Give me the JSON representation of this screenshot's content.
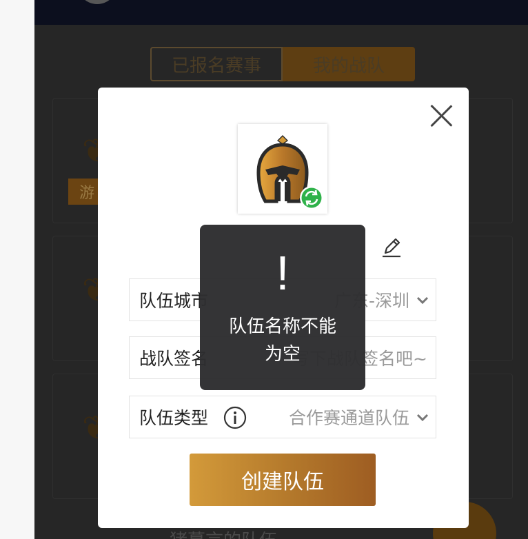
{
  "tabs": [
    "已报名赛事",
    "我的战队"
  ],
  "background_cards": [
    {
      "tag": "游"
    },
    {
      "tag": ""
    },
    {
      "tag": ""
    }
  ],
  "background_bottom_title": "猪蔓言的队伍",
  "modal": {
    "fields": [
      {
        "label": "队伍城市",
        "value": "广东-深圳",
        "icon": "chevron-down-icon"
      },
      {
        "label": "战队签名",
        "placeholder": "写下战队签名吧~"
      },
      {
        "label": "队伍类型",
        "value": "合作赛通道队伍",
        "icon": "chevron-down-icon",
        "info_icon": "info-icon"
      }
    ],
    "create_button": "创建队伍"
  },
  "toast": {
    "icon": "!",
    "message_line1": "队伍名称不能",
    "message_line2": "为空"
  },
  "colors": {
    "gold_start": "#d39a3a",
    "gold_end": "#9e5d22",
    "refresh_badge": "#2fb24a"
  }
}
